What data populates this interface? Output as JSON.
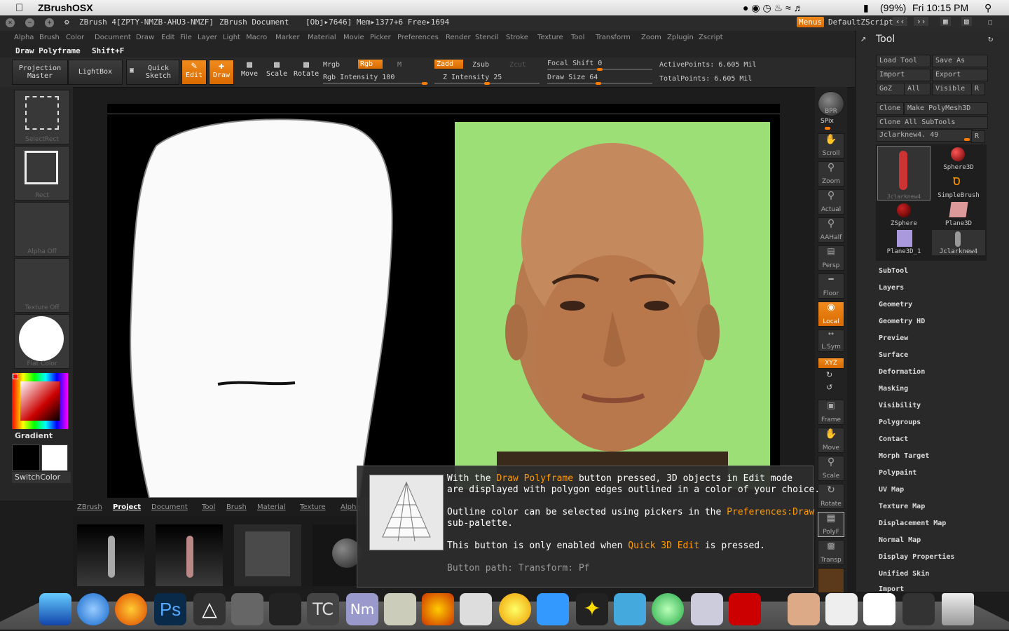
{
  "mac": {
    "app_name": "ZBrushOSX",
    "battery": "(99%)",
    "clock": "Fri 10:15 PM"
  },
  "titlebar": {
    "app": "ZBrush 4[ZPTY-NMZB-AHU3-NMZF]",
    "doc": "ZBrush Document",
    "stats": "[Obj▸7646] Mem▸1377+6 Free▸1694",
    "menus_btn": "Menus",
    "script": "DefaultZScript"
  },
  "menus": [
    "Alpha",
    "Brush",
    "Color",
    "Document",
    "Draw",
    "Edit",
    "File",
    "Layer",
    "Light",
    "Macro",
    "Marker",
    "Material",
    "Movie",
    "Picker",
    "Preferences",
    "Render",
    "Stencil",
    "Stroke",
    "Texture",
    "Tool",
    "Transform",
    "Zoom",
    "Zplugin",
    "Zscript"
  ],
  "status": {
    "label": "Draw Polyframe",
    "shortcut": "Shift+F"
  },
  "shelf": {
    "projection_master_1": "Projection",
    "projection_master_2": "Master",
    "lightbox": "LightBox",
    "quick_sketch_1": "Quick",
    "quick_sketch_2": "Sketch",
    "edit": "Edit",
    "draw": "Draw",
    "move": "Move",
    "scale": "Scale",
    "rotate": "Rotate",
    "mrgb": "Mrgb",
    "rgb": "Rgb",
    "m": "M",
    "rgb_intensity": "Rgb Intensity 100",
    "zadd": "Zadd",
    "zsub": "Zsub",
    "zcut": "Zcut",
    "z_intensity": "Z Intensity 25",
    "focal_shift": "Focal Shift 0",
    "draw_size": "Draw Size 64",
    "active_points": "ActivePoints: 6.605 Mil",
    "total_points": "TotalPoints: 6.605 Mil"
  },
  "left": {
    "selectrect": "SelectRect",
    "rect": "Rect",
    "alpha_off": "Alpha Off",
    "texture_off": "Texture Off",
    "flat_color": "Flat Color",
    "gradient": "Gradient",
    "switchcolor": "SwitchColor"
  },
  "righttb": [
    "BPR",
    "SPix",
    "Scroll",
    "Zoom",
    "Actual",
    "AAHalf",
    "Persp",
    "Floor",
    "Local",
    "L.Sym",
    "XYZ",
    "Frame",
    "Move",
    "Scale",
    "Rotate",
    "PolyF",
    "Transp"
  ],
  "tool": {
    "title": "Tool",
    "load_tool": "Load Tool",
    "save_as": "Save As",
    "import": "Import",
    "export": "Export",
    "goz": "GoZ",
    "all": "All",
    "visible": "Visible",
    "r": "R",
    "clone": "Clone",
    "make_polymesh": "Make PolyMesh3D",
    "clone_all": "Clone All SubTools",
    "current": "Jclarknew4. 49",
    "thumbs": [
      "Jclarknew4",
      "Sphere3D",
      "SimpleBrush",
      "ZSphere",
      "Plane3D",
      "Plane3D_1",
      "Jclarknew4"
    ],
    "items": [
      "SubTool",
      "Layers",
      "Geometry",
      "Geometry HD",
      "Preview",
      "Surface",
      "Deformation",
      "Masking",
      "Visibility",
      "Polygroups",
      "Contact",
      "Morph Target",
      "Polypaint",
      "UV Map",
      "Texture Map",
      "Displacement Map",
      "Normal Map",
      "Display Properties",
      "Unified Skin",
      "Import"
    ]
  },
  "bottom_tabs": [
    "ZBrush",
    "Project",
    "Document",
    "Tool",
    "Brush",
    "Material",
    "Texture",
    "Alpha"
  ],
  "tooltip": {
    "l1a": "With the ",
    "l1b": "Draw Polyframe",
    "l1c": " button pressed, 3D objects in Edit mode",
    "l2": "are displayed with polygon edges outlined in a color of your choice.",
    "l3a": "Outline color can be selected using pickers in the ",
    "l3b": "Preferences:Draw",
    "l4": "sub-palette.",
    "l5a": "This  button  is  only  enabled  when ",
    "l5b": "Quick  3D  Edit",
    "l5c": "  is  pressed.",
    "path": "Button path: Transform: Pf"
  },
  "dock_icons": [
    "finder-icon",
    "safari-icon",
    "firefox-icon",
    "photoshop-icon",
    "unity-icon",
    "app-icon",
    "app-icon",
    "textcraft-icon",
    "nm-icon",
    "pen-icon",
    "audio-icon",
    "printer-icon",
    "adium-icon",
    "app-icon",
    "runner-icon",
    "messenger-icon",
    "app-icon",
    "preview-icon",
    "acrobat-icon",
    "app-icon",
    "mail-icon",
    "folder-icon",
    "folder-icon",
    "folder-icon",
    "trash-icon"
  ]
}
